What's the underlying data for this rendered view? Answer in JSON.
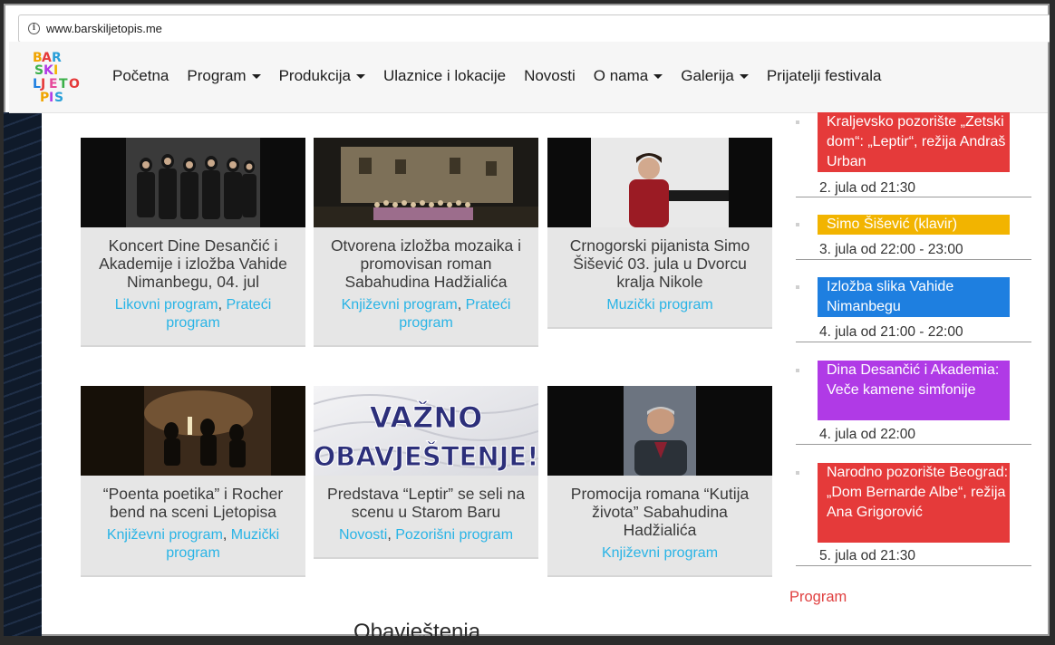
{
  "browser": {
    "url": "www.barskiljetopis.me"
  },
  "logo": {
    "text": "BAR SKI LJETO PIS"
  },
  "nav": {
    "items": [
      {
        "label": "Početna",
        "dropdown": false
      },
      {
        "label": "Program",
        "dropdown": true
      },
      {
        "label": "Produkcija",
        "dropdown": true
      },
      {
        "label": "Ulaznice i lokacije",
        "dropdown": false
      },
      {
        "label": "Novosti",
        "dropdown": false
      },
      {
        "label": "O nama",
        "dropdown": true
      },
      {
        "label": "Galerija",
        "dropdown": true
      },
      {
        "label": "Prijatelji festivala",
        "dropdown": false
      }
    ]
  },
  "cards": [
    {
      "title": "Koncert Dine Desančić i Akademije i izložba Vahide Nimanbegu, 04. jul",
      "tags": [
        "Likovni program",
        "Prateći program"
      ]
    },
    {
      "title": "Otvorena izložba mozaika i promovisan roman Sabahudina Hadžialića",
      "tags": [
        "Književni program",
        "Prateći program"
      ]
    },
    {
      "title": "Crnogorski pijanista Simo Šišević 03. jula u Dvorcu kralja Nikole",
      "tags": [
        "Muzički program"
      ]
    },
    {
      "title": "“Poenta poetika” i Rocher bend na sceni Ljetopisa",
      "tags": [
        "Književni program",
        "Muzički program"
      ]
    },
    {
      "title": "Predstava “Leptir” se seli na scenu u Starom Baru",
      "tags": [
        "Novosti",
        "Pozorišni program"
      ]
    },
    {
      "title": "Promocija romana “Kutija života” Sabahudina Hadžialića",
      "tags": [
        "Književni program"
      ]
    }
  ],
  "thumbs": {
    "card5_text": [
      "VAŽNO",
      "OBAVJEŠTENJE!"
    ]
  },
  "sidebar": {
    "events": [
      {
        "label": "Kraljevsko pozorište „Zetski dom“: „Leptir“, režija Andraš Urban",
        "date": "2. jula od 21:30",
        "color": "#e53a3a"
      },
      {
        "label": "Simo Šišević (klavir)",
        "date": "3. jula od 22:00 - 23:00",
        "color": "#f2b400"
      },
      {
        "label": "Izložba slika Vahide Nimanbegu",
        "date": "4. jula od 21:00 - 22:00",
        "color": "#1e7fe0"
      },
      {
        "label": "Dina Desančić i Akademia: Veče kamene simfonije",
        "date": "4. jula od 22:00",
        "color": "#b03ae6"
      },
      {
        "label": "Narodno pozorište Beograd: „Dom Bernarde Albe“, režija Ana Grigorović",
        "date": "5. jula od 21:30",
        "color": "#e53a3a"
      }
    ],
    "program_link": "Program"
  },
  "section_title": "Obavještenja",
  "colors": {
    "tag_link": "#29b4e6",
    "program_link": "#e04040",
    "card_bg": "#e6e6e6"
  }
}
